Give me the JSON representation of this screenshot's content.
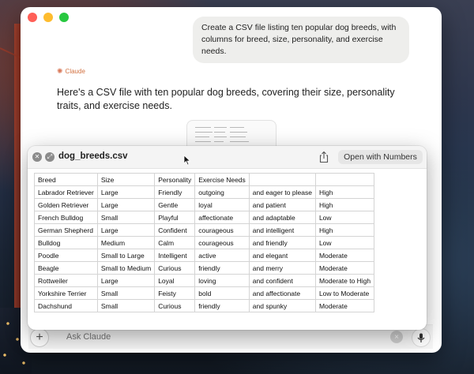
{
  "app": {
    "user_message": "Create a CSV file listing ten popular dog breeds, with columns for breed, size, personality, and exercise needs.",
    "assistant_label": "Claude",
    "assistant_message": "Here's a CSV file with ten popular dog breeds, covering their size, personality traits, and exercise needs."
  },
  "composer": {
    "placeholder": "Ask Claude"
  },
  "preview": {
    "filename": "dog_breeds.csv",
    "open_button": "Open with Numbers",
    "rows": [
      [
        "Breed",
        "Size",
        "Personality",
        "Exercise Needs",
        "",
        ""
      ],
      [
        "Labrador Retriever",
        "Large",
        "Friendly",
        "outgoing",
        "and eager to please",
        "High"
      ],
      [
        "Golden Retriever",
        "Large",
        "Gentle",
        "loyal",
        "and patient",
        "High"
      ],
      [
        "French Bulldog",
        "Small",
        "Playful",
        "affectionate",
        "and adaptable",
        "Low"
      ],
      [
        "German Shepherd",
        "Large",
        "Confident",
        "courageous",
        "and intelligent",
        "High"
      ],
      [
        "Bulldog",
        "Medium",
        "Calm",
        "courageous",
        "and friendly",
        "Low"
      ],
      [
        "Poodle",
        "Small to Large",
        "Intelligent",
        "active",
        "and elegant",
        "Moderate"
      ],
      [
        "Beagle",
        "Small to Medium",
        "Curious",
        "friendly",
        "and merry",
        "Moderate"
      ],
      [
        "Rottweiler",
        "Large",
        "Loyal",
        "loving",
        "and confident",
        "Moderate to High"
      ],
      [
        "Yorkshire Terrier",
        "Small",
        "Feisty",
        "bold",
        "and affectionate",
        "Low to Moderate"
      ],
      [
        "Dachshund",
        "Small",
        "Curious",
        "friendly",
        "and spunky",
        "Moderate"
      ]
    ]
  },
  "icons": {
    "close": "close-icon",
    "fullscreen": "fullscreen-icon",
    "share": "share-icon",
    "mic": "microphone-icon",
    "plus": "plus-icon",
    "clear": "clear-icon",
    "claude": "claude-spark-icon"
  },
  "colors": {
    "claude_accent": "#d97757",
    "traffic_red": "#ff5f57",
    "traffic_yellow": "#febc2e",
    "traffic_green": "#28c840"
  }
}
